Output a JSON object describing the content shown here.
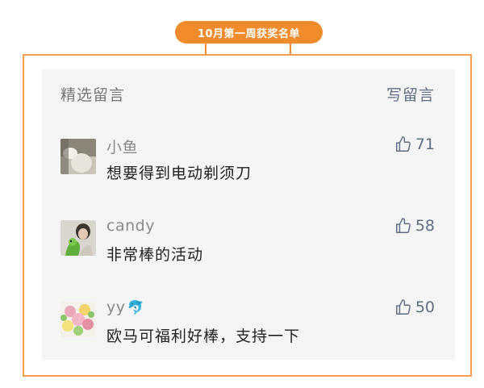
{
  "banner": {
    "title": "10月第一周获奖名单"
  },
  "panel": {
    "section_title": "精选留言",
    "write_comment_label": "写留言"
  },
  "comments": [
    {
      "username": "小鱼",
      "text": "想要得到电动剃须刀",
      "likes": "71",
      "avatar": "avatar-xiaoyu"
    },
    {
      "username": "candy",
      "text": "非常棒的活动",
      "likes": "58",
      "avatar": "avatar-candy"
    },
    {
      "username": "yy",
      "username_emoji": "dolphin-emoji",
      "text": "欧马可福利好棒，支持一下",
      "likes": "50",
      "avatar": "avatar-yy"
    }
  ],
  "colors": {
    "accent_orange": "#f08c2b",
    "link_blue_gray": "#5f6d85",
    "panel_bg": "#f5f5f5"
  }
}
